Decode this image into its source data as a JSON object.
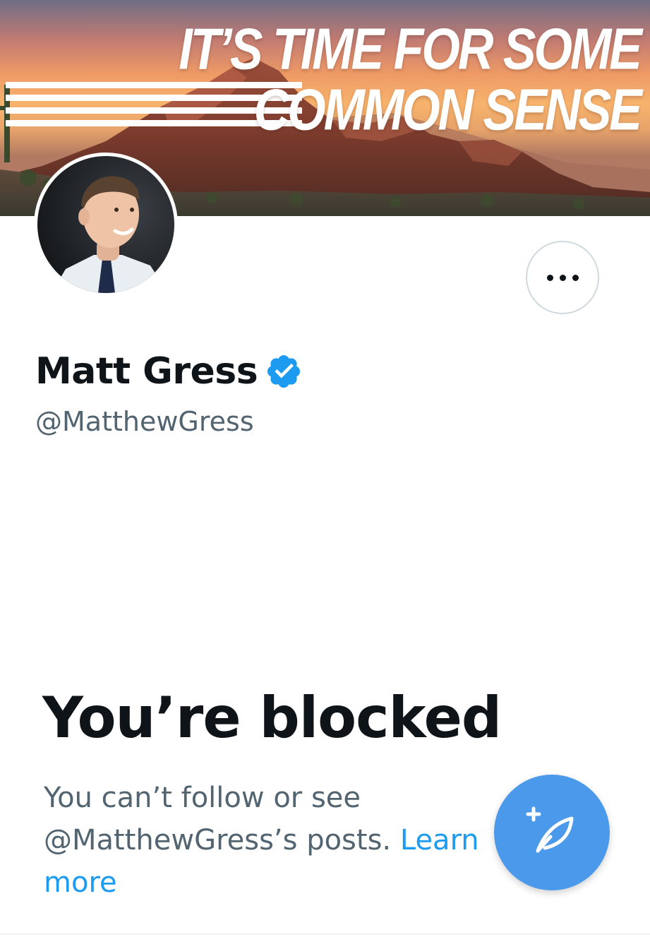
{
  "banner": {
    "line1": "IT’S TIME FOR SOME",
    "line2": "COMMON SENSE"
  },
  "profile": {
    "display_name": "Matt Gress",
    "handle": "@MatthewGress",
    "verified": true,
    "verified_badge_color": "#1d9bf0"
  },
  "actions": {
    "more_icon": "more-horizontal-icon"
  },
  "blocked": {
    "title": "You’re blocked",
    "message": "You can’t follow or see @MatthewGress’s posts.",
    "learn_more": "Learn more"
  },
  "fab": {
    "icon": "compose-post-icon",
    "color": "#4a99ea"
  },
  "colors": {
    "text_primary": "#0f1419",
    "text_secondary": "#536471",
    "accent": "#1d9bf0"
  }
}
